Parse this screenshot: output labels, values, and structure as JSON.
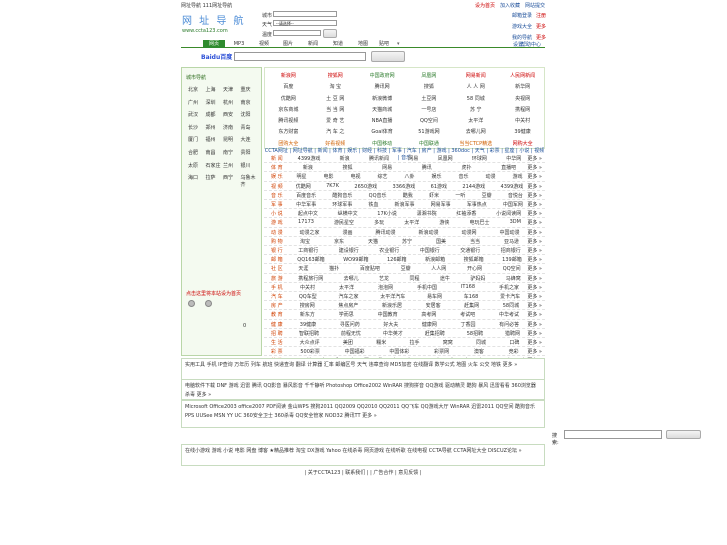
{
  "topbar": {
    "left_text": "网址导航 111网址导航",
    "right_links": [
      "设为首页",
      "加入收藏",
      "网站提交"
    ]
  },
  "logo": {
    "title": "网 址 导 航",
    "url": "www.ccta123.com"
  },
  "weather": {
    "label1": "城市",
    "label2": "天气",
    "label3": "温度",
    "city_select": "--请选择--"
  },
  "right_panel": {
    "rows": [
      [
        "邮箱登录",
        "注册"
      ],
      [
        "游戏大全",
        "更多"
      ],
      [
        "我的导航",
        "更多"
      ]
    ]
  },
  "tabs": [
    "网页",
    "MP3",
    "视频",
    "图片",
    "新闻",
    "知道",
    "地图",
    "贴吧"
  ],
  "tab_right": [
    "设置",
    "帮助中心"
  ],
  "search": {
    "logo": "Baidu百度",
    "placeholder": "",
    "button": ""
  },
  "left_panel": {
    "title": "城市导航",
    "cities": [
      "北京",
      "上海",
      "天津",
      "重庆",
      "广州",
      "深圳",
      "杭州",
      "南京",
      "武汉",
      "成都",
      "西安",
      "沈阳",
      "长沙",
      "郑州",
      "济南",
      "青岛",
      "厦门",
      "福州",
      "昆明",
      "大连",
      "合肥",
      "南昌",
      "南宁",
      "贵阳",
      "太原",
      "石家庄",
      "兰州",
      "银川",
      "海口",
      "拉萨",
      "西宁",
      "乌鲁木齐"
    ],
    "link": "点击这里将本站设为首页",
    "num": "0"
  },
  "hot_sites": [
    [
      "新浪网",
      "搜狐网",
      "中国政府网",
      "凤凰网",
      "网易新闻",
      "人民网新闻"
    ],
    [
      "百度",
      "淘 宝",
      "腾讯网",
      "搜狐",
      "人 人 网",
      "新华网"
    ],
    [
      "优酷网",
      "土 豆 网",
      "新浪微博",
      "土豆网",
      "58 同城",
      "央视网"
    ],
    [
      "京东商城",
      "当 当 网",
      "天猫商城",
      "一号店",
      "苏 宁",
      "携程网"
    ],
    [
      "腾讯视频",
      "爱 奇 艺",
      "NBA直播",
      "QQ空间",
      "太平洋",
      "中关村"
    ],
    [
      "东方财富",
      "汽 车 之",
      "Goal体育",
      "51游戏网",
      "去哪儿网",
      "39健康"
    ],
    [
      "团购大全",
      "好看视频",
      "中国移动",
      "中国联通",
      "当当CTCP精选",
      "网购大全"
    ]
  ],
  "notice": "CCTA网址 | 网址导航 | 新闻 | 体育 | 娱乐 | 财经 | 科技 | 军事 | 汽车 | 房产 | 游戏 | 360doc | 天气 | 彩票 | 星座 | 小说 | 视频 | 音乐",
  "categories": [
    {
      "name": "新 闻",
      "items": [
        "4399游戏",
        "新浪",
        "腾讯新闻",
        "网易",
        "凤凰网",
        "环球网",
        "中华网"
      ]
    },
    {
      "name": "体 育",
      "items": [
        "新浪",
        "搜狐",
        "网易",
        "腾讯",
        "虎扑",
        "直播吧"
      ]
    },
    {
      "name": "娱 乐",
      "items": [
        "明星",
        "电影",
        "电视",
        "综艺",
        "八卦",
        "娱乐",
        "音乐",
        "动漫",
        "游戏"
      ]
    },
    {
      "name": "视 频",
      "items": [
        "优酷网",
        "7K7K",
        "2650游戏",
        "3366游戏",
        "61游戏",
        "2144游戏",
        "4399游戏"
      ]
    },
    {
      "name": "音 乐",
      "items": [
        "百度音乐",
        "酷狗音乐",
        "QQ音乐",
        "酷我",
        "虾米",
        "一听",
        "豆瓣",
        "音悦台"
      ]
    },
    {
      "name": "军 事",
      "items": [
        "中华军事",
        "环球军事",
        "铁血",
        "新浪军事",
        "网易军事",
        "军事热点",
        "中国军网"
      ]
    },
    {
      "name": "小 说",
      "items": [
        "起点中文",
        "纵横中文",
        "17K小说",
        "潇湘书院",
        "红袖添香",
        "小说阅读网"
      ]
    },
    {
      "name": "游 戏",
      "items": [
        "17173",
        "游民星空",
        "多玩",
        "太平洋",
        "游侠",
        "电玩巴士",
        "3DM"
      ]
    },
    {
      "name": "动 漫",
      "items": [
        "动漫之家",
        "漫画",
        "腾讯动漫",
        "新浪动漫",
        "动漫网",
        "中国动漫"
      ]
    },
    {
      "name": "购 物",
      "items": [
        "淘宝",
        "京东",
        "天猫",
        "苏宁",
        "国美",
        "当当",
        "亚马逊"
      ]
    },
    {
      "name": "银 行",
      "items": [
        "工商银行",
        "建设银行",
        "农业银行",
        "中国银行",
        "交通银行",
        "招商银行"
      ]
    },
    {
      "name": "邮 箱",
      "items": [
        "QQ163邮箱",
        "WO99邮箱",
        "126邮箱",
        "新浪邮箱",
        "搜狐邮箱",
        "139邮箱"
      ]
    },
    {
      "name": "社 区",
      "items": [
        "天涯",
        "猫扑",
        "百度贴吧",
        "豆瓣",
        "人人网",
        "开心网",
        "QQ空间"
      ]
    },
    {
      "name": "旅 游",
      "items": [
        "携程旅行网",
        "去哪儿",
        "艺龙",
        "同程",
        "途牛",
        "驴妈妈",
        "马蜂窝"
      ]
    },
    {
      "name": "手 机",
      "items": [
        "中关村",
        "太平洋",
        "泡泡网",
        "手机中国",
        "IT168",
        "手机之家"
      ]
    },
    {
      "name": "汽 车",
      "items": [
        "QQ车型",
        "汽车之家",
        "太平洋汽车",
        "易车网",
        "车168",
        "爱卡汽车"
      ]
    },
    {
      "name": "房 产",
      "items": [
        "搜房网",
        "焦点房产",
        "新浪乐居",
        "安居客",
        "赶集网",
        "58同城"
      ]
    },
    {
      "name": "教 育",
      "items": [
        "新东方",
        "学而思",
        "中国教育",
        "高考网",
        "考试吧",
        "中华考试"
      ]
    },
    {
      "name": "健 康",
      "items": [
        "39健康",
        "寻医问药",
        "好大夫",
        "健康网",
        "丁香园",
        "有问必答"
      ]
    },
    {
      "name": "招 聘",
      "items": [
        "智联招聘",
        "前程无忧",
        "中华英才",
        "赶集招聘",
        "58招聘",
        "猎聘网"
      ]
    },
    {
      "name": "生 活",
      "items": [
        "大众点评",
        "美团",
        "糯米",
        "拉手",
        "窝窝",
        "同城",
        "口碑"
      ]
    },
    {
      "name": "彩 票",
      "items": [
        "500彩票",
        "中国福彩",
        "中国体彩",
        "彩票网",
        "澳客",
        "竞彩"
      ]
    },
    {
      "name": "其 他",
      "items": [
        "天",
        "地",
        "人",
        "和",
        "春",
        "夏",
        "秋",
        "冬",
        "东",
        "西",
        "南",
        "北",
        "中",
        "上",
        "下",
        "左",
        "右"
      ]
    }
  ],
  "bottom1": {
    "title": "实用工具",
    "text": "实用工具 手机  IP查询  万年历  列车  航班  快递查询  翻译  计算器  汇率  邮编区号  天气  违章查询  MD5加密  在线翻译  数学公式  地图  火车  公交  地铁  更多 »"
  },
  "bottom2": {
    "title": "电脑软件下载",
    "text": "电脑软件下载  DNF  游戏  迅雷  腾讯  QQ影音  暴风影音  千千静听  Photoshop  Office2002  WinRAR  搜狗拼音  QQ游戏  驱动精灵  酷狗  暴风  迅雷看看  360浏览器  杀毒  更多 »"
  },
  "bottom3": {
    "text": "Microsoft Office2003  office2007  PDF阅读  金山WPS  搜狗2011  QQ2009  QQ2010  QQ2011  QQ飞车  QQ游戏大厅  WinRAR  迅雷2011  QQ空间  酷狗音乐  PPS  UUSee  MSN  YY  UC  360安全卫士  360杀毒  QQ安全管家  NOD32  腾讯TT  更多 »"
  },
  "bottom4": {
    "text": "在线小游戏 游戏  小说  电影  网盘  博客  ★精品推荐  淘宝  DX游戏  Yahoo  在线杀毒  网页游戏  在线听歌  在线电视  CCTA导航  CCTA网址大全  DISCUZ论坛  »"
  },
  "footer": "| 关于CCTA123 | 联系我们 | | 广告合作 | 意见反馈 |",
  "footer_search": {
    "label": "搜索:",
    "button": ""
  }
}
